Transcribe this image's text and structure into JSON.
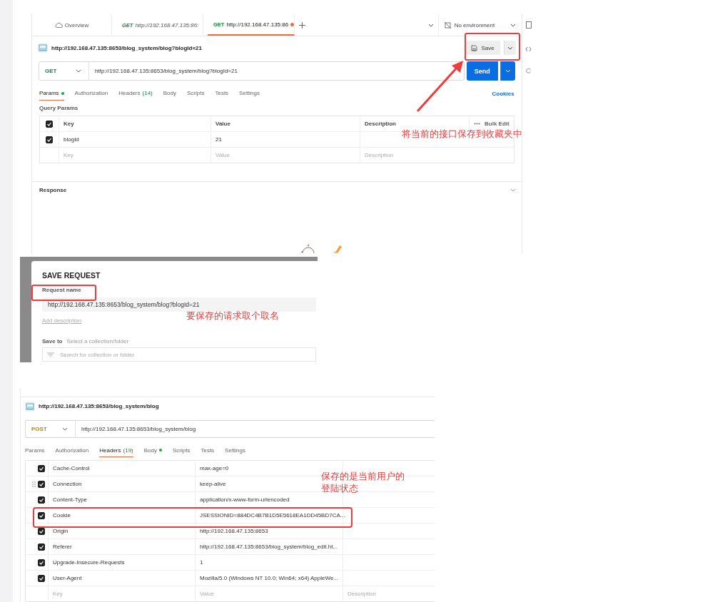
{
  "screenshot_1": {
    "tabs": [
      {
        "kind": "overview",
        "label": "Overview",
        "selected": false
      },
      {
        "kind": "get",
        "method": "GET",
        "label": "http://192.168.47.135:86:",
        "preview": true,
        "unsaved": false,
        "selected": false
      },
      {
        "kind": "get",
        "method": "GET",
        "label": "http://192.168.47.135:86",
        "preview": false,
        "unsaved": true,
        "selected": true
      }
    ],
    "environment": "No environment",
    "request_title": "http://192.168.47.135:8653/blog_system/blog?blogId=21",
    "save_button": "Save",
    "method": {
      "kind": "get",
      "label": "GET"
    },
    "url": "http://192.168.47.135:8653/blog_system/blog?blogId=21",
    "send_button": "Send",
    "request_tabs": [
      {
        "label": "Params",
        "dot": true,
        "selected": true
      },
      {
        "label": "Authorization",
        "dot": false,
        "selected": false
      },
      {
        "label": "Headers",
        "count": "(14)",
        "dot": false,
        "selected": false
      },
      {
        "label": "Body",
        "dot": false,
        "selected": false
      },
      {
        "label": "Scripts",
        "dot": false,
        "selected": false
      },
      {
        "label": "Tests",
        "dot": false,
        "selected": false
      },
      {
        "label": "Settings",
        "dot": false,
        "selected": false
      }
    ],
    "cookies": "Cookies",
    "section_title": "Query Params",
    "table": {
      "all_checked": true,
      "columns": [
        "Key",
        "Value",
        "Description"
      ],
      "bulk_edit": "Bulk Edit",
      "rows": [
        {
          "checked": true,
          "key": "blogId",
          "value": "21"
        }
      ],
      "placeholder_row": {
        "key": "Key",
        "value": "Value",
        "description": "Description"
      }
    },
    "response_title": "Response"
  },
  "screenshot_2": {
    "title": "SAVE REQUEST",
    "name_label": "Request name",
    "name_value": "http://192.168.47.135:8653/blog_system/blog?blogId=21",
    "add_description": "Add description",
    "save_to_label": "Save to",
    "save_to_hint": "Select a collection/folder",
    "search_placeholder": "Search for collection or folder"
  },
  "screenshot_3": {
    "request_title": "http://192.168.47.135:8653/blog_system/blog",
    "method": {
      "kind": "post",
      "label": "POST"
    },
    "url": "http://192.168.47.135:8653/blog_system/blog",
    "request_tabs": [
      {
        "label": "Params",
        "dot": false,
        "selected": false
      },
      {
        "label": "Authorization",
        "dot": false,
        "selected": false
      },
      {
        "label": "Headers",
        "count": "(19)",
        "dot": false,
        "selected": true
      },
      {
        "label": "Body",
        "dot": true,
        "selected": false
      },
      {
        "label": "Scripts",
        "dot": false,
        "selected": false
      },
      {
        "label": "Tests",
        "dot": false,
        "selected": false
      },
      {
        "label": "Settings",
        "dot": false,
        "selected": false
      }
    ],
    "headers": [
      {
        "checked": true,
        "handle": false,
        "key": "Cache-Control",
        "value": "max-age=0"
      },
      {
        "checked": true,
        "handle": true,
        "key": "Connection",
        "value": "keep-alive"
      },
      {
        "checked": true,
        "handle": false,
        "key": "Content-Type",
        "value": "application/x-www-form-urlencoded"
      },
      {
        "checked": true,
        "handle": false,
        "key": "Cookie",
        "value": "JSESSIONID=884DC4B7B1D5E5618EA1DD45BD7CA..."
      },
      {
        "checked": true,
        "handle": false,
        "key": "Origin",
        "value": "http://192.168.47.135:8653"
      },
      {
        "checked": true,
        "handle": false,
        "key": "Referer",
        "value": "http://192.168.47.135:8653/blog_system/blog_edit.ht..."
      },
      {
        "checked": true,
        "handle": false,
        "key": "Upgrade-Insecure-Requests",
        "value": "1"
      },
      {
        "checked": true,
        "handle": false,
        "key": "User-Agent",
        "value": "Mozilla/5.0 (Windows NT 10.0; Win64; x64) AppleWe..."
      }
    ],
    "placeholder_row": {
      "key": "Key",
      "value": "Value",
      "description": "Description"
    }
  },
  "annotations": {
    "save_note": "将当前的接口保存到收藏夹中",
    "name_note": "要保存的请求取个取名",
    "cookie_note": "保存的是当前用户的登陆状态"
  }
}
